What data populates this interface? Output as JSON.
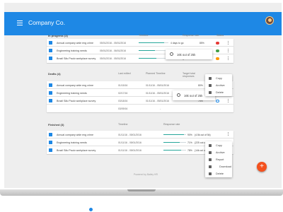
{
  "app": {
    "title": "Company Co.",
    "menu_icon": "menu-icon",
    "avatar": "user-avatar"
  },
  "colors": {
    "primary": "#1e88e5",
    "accent": "#f4511e",
    "bar": "#26a69a",
    "status_red": "#e53935",
    "status_orange": "#ff9800",
    "status_blue": "#1e88e5"
  },
  "in_progress": {
    "label": "In progress (3)",
    "columns": {
      "timeline": "Timeline",
      "response_rate": "Response rate",
      "status": "Status"
    },
    "rows": [
      {
        "name": "Annual company wide eng crime",
        "dates": "05/01/2016 - 05/01/2016",
        "note": "4 days to go",
        "pct": "85%",
        "progress": 0.85,
        "status": "red"
      },
      {
        "name": "Engineering training needs",
        "dates": "05/01/2016 - 06/01/2016",
        "note": "",
        "pct": "",
        "progress": 0.55,
        "status": "green"
      },
      {
        "name": "Brazil São Paulo workplace survey",
        "dates": "05/01/2016 - 05/01/2016",
        "note": "1 month to go",
        "pct": "",
        "progress": 0.6,
        "status": "orange"
      }
    ]
  },
  "tooltip1": {
    "text": "16k out of 25k"
  },
  "menu1": {
    "items": [
      {
        "label": "Copy",
        "icon": "copy-icon"
      },
      {
        "label": "Archive",
        "icon": "archive-icon"
      },
      {
        "label": "Delete",
        "icon": "delete-icon"
      }
    ]
  },
  "drafts": {
    "label": "Drafts (4)",
    "columns": {
      "last_edited": "Last edited",
      "planned_timeline": "Planned Timeline",
      "target_total": "Target total responses"
    },
    "rows": [
      {
        "name": "Annual company wide eng crime",
        "edited": "01/15/16",
        "dates": "01/11/16 - 05/01/2016",
        "pct": "80%",
        "progress": 0.8
      },
      {
        "name": "Engineering training needs",
        "edited": "02/17/16",
        "dates": "01/11/16 - 05/01/2016",
        "pct": "",
        "progress": 0.0
      },
      {
        "name": "Brazil São Paulo workplace survey",
        "edited": "03/18/16",
        "dates": "01/11/16 - 05/01/2016",
        "pct": "79%",
        "progress": 0.79
      },
      {
        "name": "",
        "edited": "03/09/16",
        "dates": "-",
        "pct": "",
        "progress": 0.0
      }
    ]
  },
  "tooltip2": {
    "text": "16k out of 25k"
  },
  "finished": {
    "label": "Finished (3)",
    "columns": {
      "timeline": "Timeline",
      "response_rate": "Response rate"
    },
    "rows": [
      {
        "name": "Annual company wide eng crime",
        "dates": "01/11/16 - 05/01/2016",
        "pct": "90%",
        "extra": "(4.5k out of 5k)",
        "progress": 0.9
      },
      {
        "name": "Engineering training needs",
        "dates": "01/11/16 - 05/01/2016",
        "pct": "71%",
        "extra": "(225 out of 300)",
        "progress": 0.71
      },
      {
        "name": "Brazil São Paulo workplace survey",
        "dates": "01/11/16 - 05/01/2016",
        "pct": "78%",
        "extra": "(14k out of 18k)",
        "progress": 0.78
      }
    ]
  },
  "menu2": {
    "items": [
      {
        "label": "Copy",
        "icon": "copy-icon"
      },
      {
        "label": "Archive",
        "icon": "archive-icon"
      },
      {
        "label": "Report",
        "icon": "report-icon"
      },
      {
        "label": "Download",
        "icon": "download-icon"
      },
      {
        "label": "Delete",
        "icon": "delete-icon"
      }
    ]
  },
  "footer": {
    "powered": "Powered by Bailey HR"
  },
  "fab": {
    "label": "+"
  }
}
